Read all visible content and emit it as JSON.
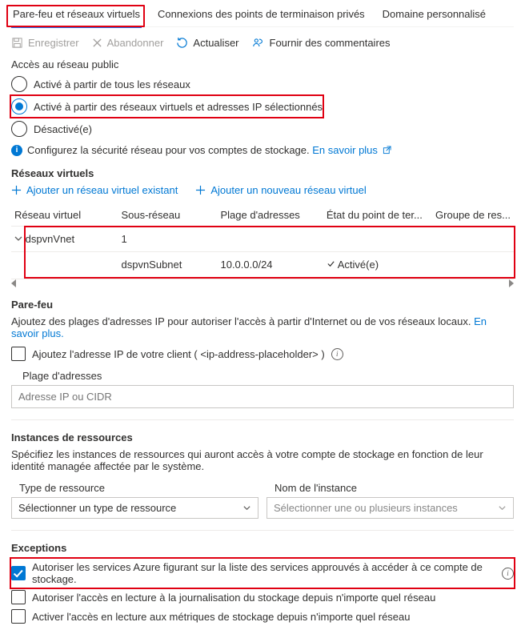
{
  "tabs": [
    {
      "id": "firewall",
      "label": "Pare-feu et réseaux virtuels",
      "selected": true,
      "highlight": true
    },
    {
      "id": "pe",
      "label": "Connexions des points de terminaison privés"
    },
    {
      "id": "cd",
      "label": "Domaine personnalisé"
    }
  ],
  "commands": {
    "save": "Enregistrer",
    "discard": "Abandonner",
    "refresh": "Actualiser",
    "feedback": "Fournir des commentaires"
  },
  "publicAccess": {
    "title": "Accès au réseau public",
    "options": [
      {
        "id": "all",
        "label": "Activé à partir de tous les réseaux"
      },
      {
        "id": "selected",
        "label": "Activé à partir des réseaux virtuels et adresses IP sélectionnés"
      },
      {
        "id": "disabled",
        "label": "Désactivé(e)"
      }
    ],
    "selected": "selected",
    "info": "Configurez la sécurité réseau pour vos comptes de stockage.",
    "learn": "En savoir plus"
  },
  "vnets": {
    "title": "Réseaux virtuels",
    "addExisting": "Ajouter un réseau virtuel existant",
    "addNew": "Ajouter un nouveau réseau virtuel",
    "cols": [
      "Réseau virtuel",
      "Sous-réseau",
      "Plage d'adresses",
      "État du point de ter...",
      "Groupe de res..."
    ],
    "rows": [
      {
        "vnet": "dspvnVnet",
        "subnetCount": "1"
      },
      {
        "subnet": "dspvnSubnet",
        "range": "10.0.0.0/24",
        "status": "Activé(e)"
      }
    ]
  },
  "firewall": {
    "title": "Pare-feu",
    "desc": "Ajoutez des plages d'adresses IP pour autoriser l'accès à partir d'Internet ou de vos réseaux locaux. ",
    "learn": "En savoir plus.",
    "addClient": "Ajoutez l'adresse IP de votre client ( <ip-address-placeholder> )",
    "rangeLabel": "Plage d'adresses",
    "inputPlaceholder": "Adresse IP ou CIDR"
  },
  "resourceInstances": {
    "title": "Instances de ressources",
    "desc": "Spécifiez les instances de ressources qui auront accès à votre compte de stockage en fonction de leur identité managée affectée par le système.",
    "typeLabel": "Type de ressource",
    "nameLabel": "Nom de l'instance",
    "typePlaceholder": "Sélectionner un type de ressource",
    "namePlaceholder": "Sélectionner une ou plusieurs instances"
  },
  "exceptions": {
    "title": "Exceptions",
    "items": [
      {
        "label": "Autoriser les services Azure figurant sur la liste des services approuvés à accéder à ce compte de stockage.",
        "checked": true,
        "highlight": true,
        "info": true
      },
      {
        "label": "Autoriser l'accès en lecture à la journalisation du stockage depuis n'importe quel réseau",
        "checked": false
      },
      {
        "label": "Activer l'accès en lecture aux métriques de stockage depuis n'importe quel réseau",
        "checked": false
      }
    ]
  }
}
